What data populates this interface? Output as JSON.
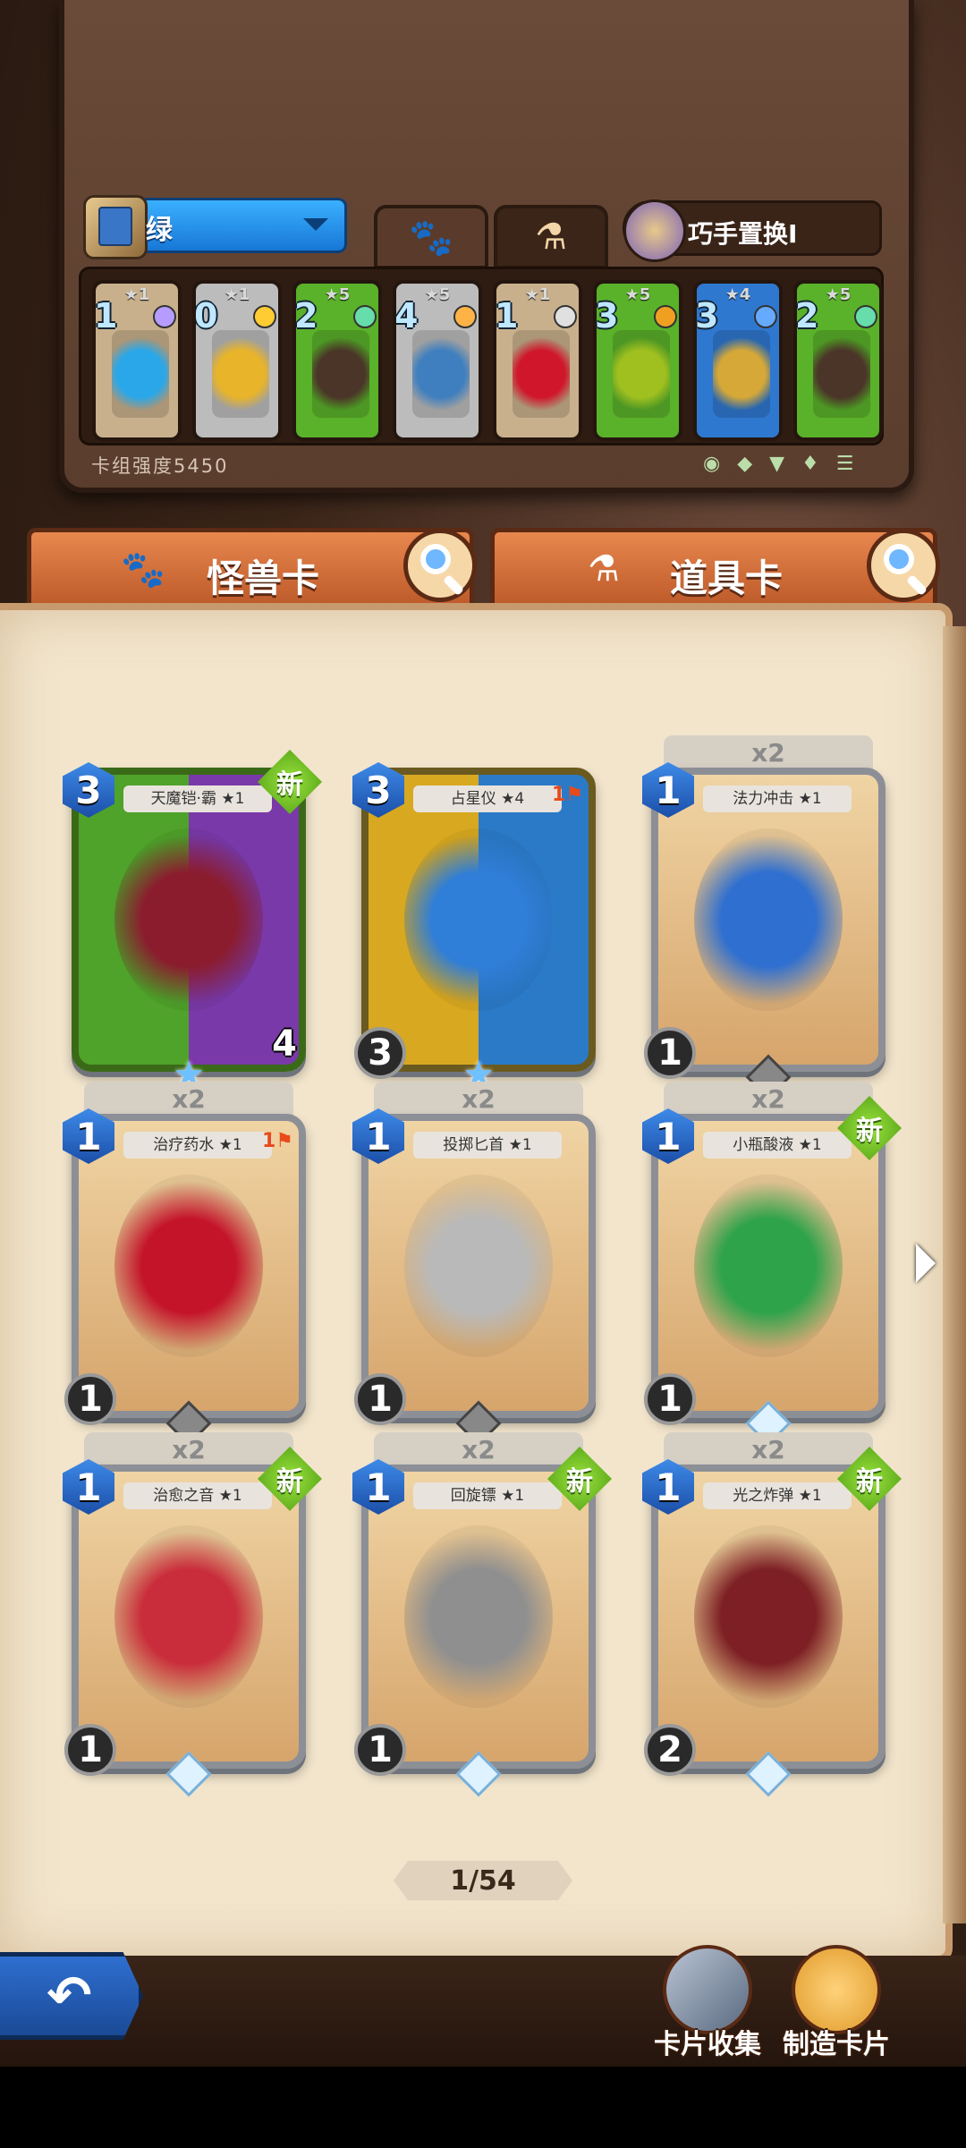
{
  "deck": {
    "name": "绿",
    "swap_label": "巧手置换I",
    "strength": "卡组强度5450",
    "cards": [
      {
        "stars": "★1",
        "cost": "1",
        "art_color": "#2aa7e8",
        "bg": "#c9b08c",
        "gem": "#b69cff"
      },
      {
        "stars": "★1",
        "cost": "0",
        "art_color": "#e8b42a",
        "bg": "#bcbcbc",
        "gem": "#ffcc33"
      },
      {
        "stars": "★5",
        "cost": "2",
        "art_color": "#4b3428",
        "bg": "#5ab12a",
        "gem": "#66ddaa"
      },
      {
        "stars": "★5",
        "cost": "4",
        "art_color": "#3f7fbf",
        "bg": "#bcbcbc",
        "gem": "#ffb347"
      },
      {
        "stars": "★1",
        "cost": "1",
        "art_color": "#d0162a",
        "bg": "#c9b08c",
        "gem": "#e0e0e0"
      },
      {
        "stars": "★5",
        "cost": "3",
        "art_color": "#a0c020",
        "bg": "#5ab12a",
        "gem": "#f0a020"
      },
      {
        "stars": "★4",
        "cost": "3",
        "art_color": "#d5a838",
        "bg": "#2f78d0",
        "gem": "#66aaff"
      },
      {
        "stars": "★5",
        "cost": "2",
        "art_color": "#4b3428",
        "bg": "#5ab12a",
        "gem": "#66ddaa"
      }
    ]
  },
  "tabs": {
    "monster": "怪兽卡",
    "item": "道具卡"
  },
  "cards": [
    {
      "title": "天魔铠·霸 ★1",
      "cost": "3",
      "count": "",
      "is_new": true,
      "new_label": "新",
      "bottom": "4",
      "left_stat": "",
      "flag": "",
      "art_color": "#8b1c2e"
    },
    {
      "title": "占星仪 ★4",
      "cost": "3",
      "count": "",
      "is_new": false,
      "new_label": "",
      "bottom": "",
      "left_stat": "3",
      "flag": "1",
      "art_color": "#2f7ed8"
    },
    {
      "title": "法力冲击 ★1",
      "cost": "1",
      "count": "x2",
      "is_new": false,
      "new_label": "",
      "bottom": "",
      "left_stat": "1",
      "flag": "",
      "art_color": "#2f6fd0"
    },
    {
      "title": "治疗药水 ★1",
      "cost": "1",
      "count": "x2",
      "is_new": false,
      "new_label": "",
      "bottom": "",
      "left_stat": "1",
      "flag": "1",
      "art_color": "#c4142a"
    },
    {
      "title": "投掷匕首 ★1",
      "cost": "1",
      "count": "x2",
      "is_new": false,
      "new_label": "",
      "bottom": "",
      "left_stat": "1",
      "flag": "",
      "art_color": "#b9b9b9"
    },
    {
      "title": "小瓶酸液 ★1",
      "cost": "1",
      "count": "x2",
      "is_new": true,
      "new_label": "新",
      "bottom": "",
      "left_stat": "1",
      "flag": "",
      "art_color": "#2fa34a"
    },
    {
      "title": "治愈之音 ★1",
      "cost": "1",
      "count": "x2",
      "is_new": true,
      "new_label": "新",
      "bottom": "",
      "left_stat": "1",
      "flag": "",
      "art_color": "#c92c3a"
    },
    {
      "title": "回旋镖 ★1",
      "cost": "1",
      "count": "x2",
      "is_new": true,
      "new_label": "新",
      "bottom": "",
      "left_stat": "1",
      "flag": "",
      "art_color": "#8f8f8f"
    },
    {
      "title": "光之炸弹 ★1",
      "cost": "1",
      "count": "x2",
      "is_new": true,
      "new_label": "新",
      "bottom": "",
      "left_stat": "2",
      "flag": "",
      "art_color": "#7d1f24"
    }
  ],
  "pager": "1/54",
  "bottom": {
    "collection": "卡片收集",
    "craft": "制造卡片"
  },
  "icons": {
    "back": "back-arrow-icon",
    "paw": "paw-icon",
    "potion": "potion-icon",
    "search": "search-icon"
  },
  "colors": {
    "accent_orange": "#d86f3a",
    "deck_blue": "#2b8ff0",
    "new_green": "#7cd12a"
  }
}
